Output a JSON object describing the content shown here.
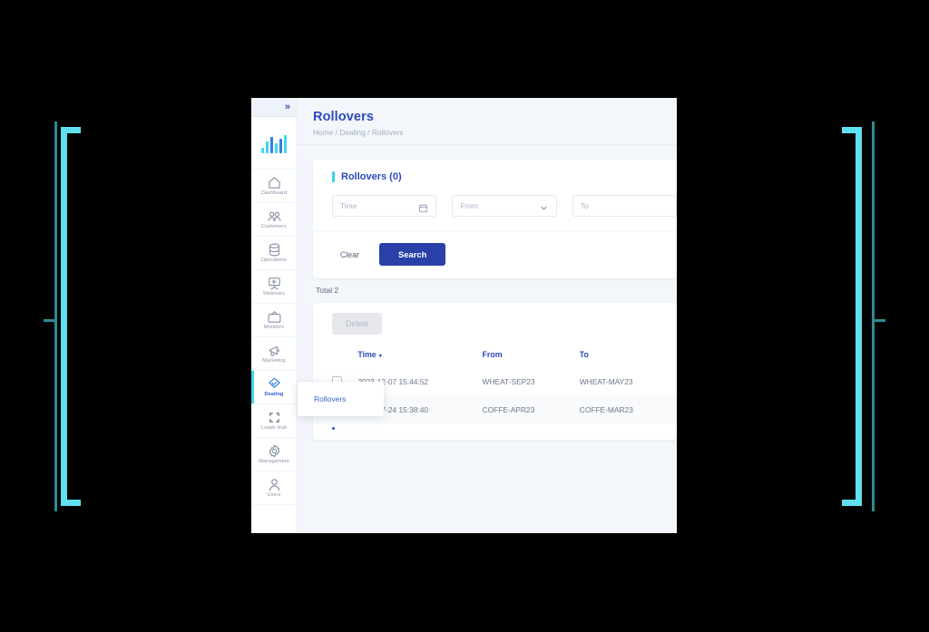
{
  "colors": {
    "accent_cyan": "#3fd6ef",
    "brand_blue": "#2b4bbd",
    "search_button": "#2840a8",
    "bracket_bright": "#5fe0f0",
    "bracket_dim": "#2f8a95",
    "page_bg": "#f3f6fa"
  },
  "sidebar": {
    "collapse_icon": "chevron-double-right-icon",
    "logo": {
      "name": "analytics-bars-logo",
      "bars": [
        {
          "h": 6,
          "color": "#3fd6ef"
        },
        {
          "h": 13,
          "color": "#3fd6ef"
        },
        {
          "h": 18,
          "color": "#2f7fe8"
        },
        {
          "h": 11,
          "color": "#3fd6ef"
        },
        {
          "h": 16,
          "color": "#2f7fe8"
        },
        {
          "h": 20,
          "color": "#3fd6ef"
        }
      ]
    },
    "items": [
      {
        "label": "Dashboard",
        "icon": "home-icon",
        "active": false
      },
      {
        "label": "Customers",
        "icon": "users-group-icon",
        "active": false
      },
      {
        "label": "Operations",
        "icon": "database-icon",
        "active": false
      },
      {
        "label": "Webinars",
        "icon": "presentation-play-icon",
        "active": false
      },
      {
        "label": "Monitors",
        "icon": "tv-monitor-icon",
        "active": false
      },
      {
        "label": "Marketing",
        "icon": "megaphone-icon",
        "active": false
      },
      {
        "label": "Dealing",
        "icon": "handshake-icon",
        "active": true
      },
      {
        "label": "Leads Hub",
        "icon": "four-arrows-expand-icon",
        "active": false
      },
      {
        "label": "Management",
        "icon": "gear-icon",
        "active": false
      },
      {
        "label": "Users",
        "icon": "user-icon",
        "active": false
      }
    ]
  },
  "submenu": {
    "items": [
      {
        "label": "Rollovers"
      }
    ]
  },
  "header": {
    "title": "Rollovers",
    "breadcrumb": "Home / Dealing / Rollovers"
  },
  "filters": {
    "card_title": "Rollovers (0)",
    "fields": [
      {
        "name": "time",
        "placeholder": "Time",
        "value": "",
        "icon": "calendar-icon"
      },
      {
        "name": "from",
        "placeholder": "From",
        "value": "",
        "icon": "chevron-down-icon"
      },
      {
        "name": "to",
        "placeholder": "To",
        "value": "",
        "icon": ""
      }
    ],
    "clear_label": "Clear",
    "search_label": "Search"
  },
  "total_label": "Total 2",
  "table": {
    "delete_label": "Delete",
    "columns": [
      {
        "key": "checkbox",
        "label": ""
      },
      {
        "key": "time",
        "label": "Time",
        "sorted": true,
        "sort_caret": "▾"
      },
      {
        "key": "from",
        "label": "From"
      },
      {
        "key": "to",
        "label": "To"
      }
    ],
    "rows": [
      {
        "checked": false,
        "time": "2023-12-07 15:44:52",
        "from": "WHEAT-SEP23",
        "to": "WHEAT-MAY23"
      },
      {
        "checked": false,
        "time": "2023-07-24 15:38:40",
        "from": "COFFE-APR23",
        "to": "COFFE-MAR23"
      }
    ]
  }
}
